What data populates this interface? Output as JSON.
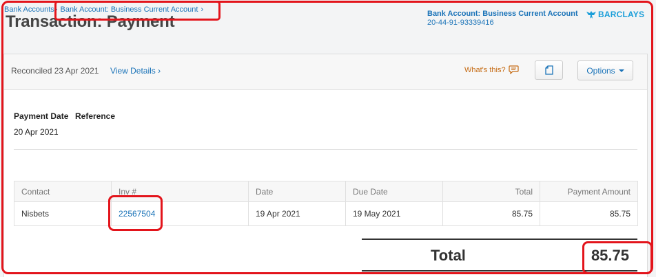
{
  "breadcrumb": {
    "items": [
      "Bank Accounts",
      "Bank Account: Business Current Account"
    ],
    "separator": "›"
  },
  "page_title": "Transaction: Payment",
  "account": {
    "name": "Bank Account: Business Current Account",
    "number": "20-44-91-93339416",
    "bank_logo_text": "BARCLAYS"
  },
  "toolbar": {
    "reconciled": "Reconciled 23 Apr 2021",
    "view_details": "View Details ›",
    "whats_this": "What's this?",
    "options": "Options"
  },
  "fields": {
    "payment_date_label": "Payment Date",
    "reference_label": "Reference",
    "payment_date_value": "20 Apr 2021"
  },
  "table": {
    "headers": [
      "Contact",
      "Inv #",
      "Date",
      "Due Date",
      "Total",
      "Payment Amount"
    ],
    "rows": [
      [
        "Nisbets",
        "22567504",
        "19 Apr 2021",
        "19 May 2021",
        "85.75",
        "85.75"
      ]
    ]
  },
  "total": {
    "label": "Total",
    "value": "85.75"
  },
  "colors": {
    "link": "#1a73b8",
    "accent_orange": "#c56a12",
    "annotation_red": "#e3141b",
    "bank_brand": "#1a9ed9"
  }
}
